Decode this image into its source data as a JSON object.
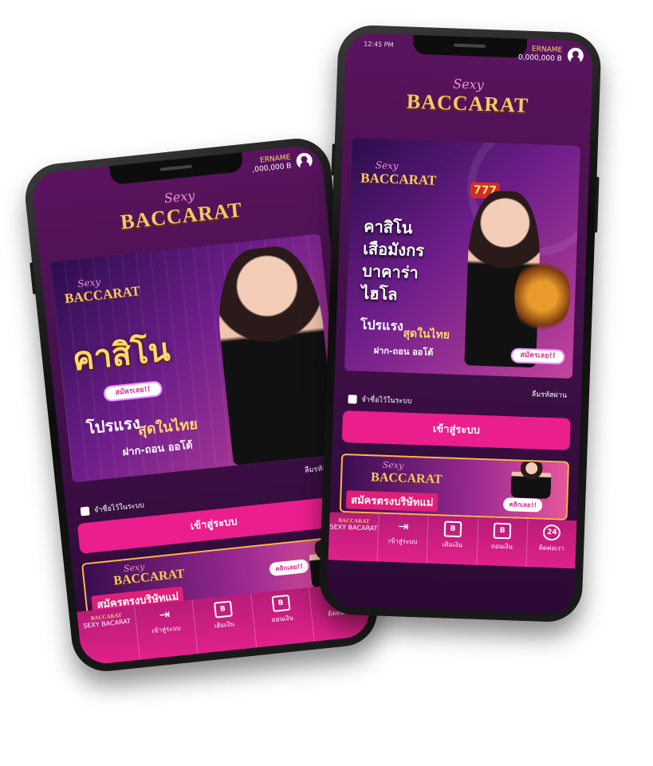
{
  "brand": {
    "script": "Sexy",
    "name": "BACCARAT"
  },
  "user": {
    "name_left": "ERNAME",
    "name_right": "ERNAME",
    "balance_left": ",000,000 B",
    "balance_right": "0,000,000 B"
  },
  "status": {
    "time": "12:45 PM"
  },
  "left_banner": {
    "headline": "คาสิโน",
    "signup_label": "สมัครเลย!!",
    "promo_line1": "โปรแรง",
    "promo_line2": "สุดในไทย",
    "promo_line3": "ฝาก-ถอน ออโต้"
  },
  "right_banner": {
    "line1": "คาสิโน",
    "line2": "เสือมังกร",
    "line3": "บาคาร่า",
    "line4": "ไฮโล",
    "promo_line1": "โปรแรง",
    "promo_line2": "สุดในไทย",
    "promo_line3": "ฝาก-ถอน ออโต้",
    "signup_label": "สมัครเลย!!",
    "slot": "777"
  },
  "form": {
    "forgot_password": "ลืมรหัสผ่าน",
    "remember_me": "จำชื่อไว้ในระบบ",
    "login_button": "เข้าสู่ระบบ"
  },
  "mini_banner": {
    "register_text": "สมัครตรงบริษัทแม่",
    "click_label": "คลิกเลย!!"
  },
  "tabbar": {
    "home_label": "SEXY BACARAT",
    "login_label": "เข้าสู่ระบบ",
    "deposit_label": "เติมเงิน",
    "withdraw_label": "ถอนเงิน",
    "contact_label": "ติดต่อเรา",
    "deposit_icon_text": "B",
    "withdraw_icon_text": "B",
    "contact_icon_text": "24"
  },
  "colors": {
    "accent": "#ea1e8d",
    "gold": "#f6c86b",
    "bg": "#3c0f45"
  }
}
